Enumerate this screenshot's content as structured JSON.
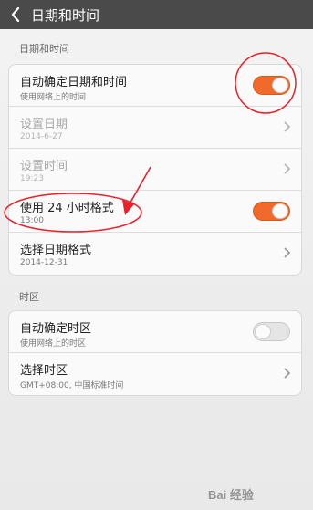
{
  "header": {
    "title": "日期和时间"
  },
  "sections": {
    "datetime_title": "日期和时间",
    "timezone_title": "时区"
  },
  "rows": {
    "auto_datetime": {
      "label": "自动确定日期和时间",
      "sub": "使用网络上的时间",
      "toggle": "on"
    },
    "set_date": {
      "label": "设置日期",
      "sub": "2014-6-27"
    },
    "set_time": {
      "label": "设置时间",
      "sub": "19:23"
    },
    "use_24h": {
      "label": "使用 24 小时格式",
      "sub": "13:00",
      "toggle": "on"
    },
    "date_format": {
      "label": "选择日期格式",
      "sub": "2014-12-31"
    },
    "auto_timezone": {
      "label": "自动确定时区",
      "sub": "使用网络上的时区",
      "toggle": "off"
    },
    "timezone": {
      "label": "选择时区",
      "sub": "GMT+08:00, 中国标准时间"
    }
  },
  "colors": {
    "header_bg": "#4a4a4a",
    "toggle_on": "#f06b2b",
    "annotation_red": "#e8202a"
  },
  "icons": [
    "back-arrow-icon",
    "chevron-right-icon"
  ],
  "watermark": "Bai 经验"
}
